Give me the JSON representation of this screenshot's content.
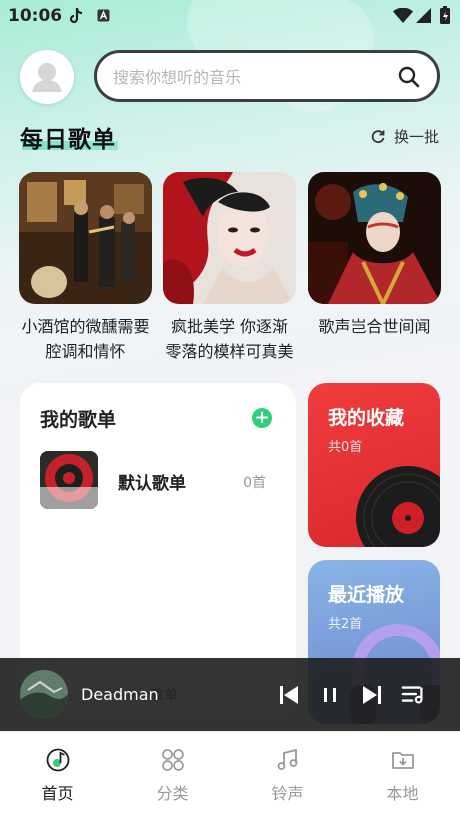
{
  "status_bar": {
    "time": "10:06"
  },
  "search": {
    "placeholder": "搜索你想听的音乐"
  },
  "daily": {
    "title": "每日歌单",
    "refresh_label": "换一批",
    "cards": [
      {
        "title": "小酒馆的微醺需要腔调和情怀"
      },
      {
        "title": "疯批美学 你逐渐零落的模样可真美"
      },
      {
        "title": "歌声岂合世间闻"
      }
    ]
  },
  "my_playlists": {
    "title": "我的歌单",
    "items": [
      {
        "name": "默认歌单",
        "count": "0首"
      }
    ],
    "hidden_label": "歌单"
  },
  "favorites": {
    "title": "我的收藏",
    "count": "共0首"
  },
  "recent": {
    "title": "最近播放",
    "count": "共2首"
  },
  "player": {
    "title": "Deadman"
  },
  "nav": {
    "items": [
      {
        "label": "首页",
        "icon": "music-note-icon",
        "active": true
      },
      {
        "label": "分类",
        "icon": "grid-icon"
      },
      {
        "label": "铃声",
        "icon": "music-notes-icon"
      },
      {
        "label": "本地",
        "icon": "download-folder-icon"
      }
    ]
  },
  "colors": {
    "accent_green": "#2fcf7c",
    "favorites_red": "#e3312f",
    "recent_blue": "#7a9bd8"
  }
}
